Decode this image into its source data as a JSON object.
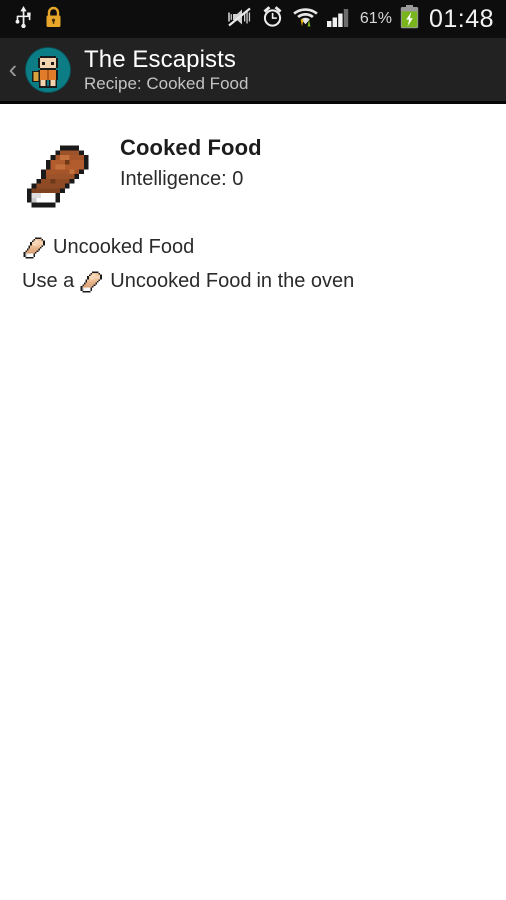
{
  "status_bar": {
    "icons": [
      "usb-icon",
      "lock-icon",
      "mute-vibrate-icon",
      "alarm-icon",
      "wifi-transfer-icon",
      "cellular-signal-icon"
    ],
    "battery_percent": "61%",
    "battery_icon": "battery-charging-icon",
    "clock": "01:48",
    "background_color": "#0d0d0d",
    "lock_color": "#e8a72b",
    "upload_arrow_color": "#79b61d",
    "download_arrow_color": "#e2b000"
  },
  "action_bar": {
    "back_label": "‹",
    "app_icon": "escapists-avatar-icon",
    "app_icon_bg": "#0d7d85",
    "title": "The Escapists",
    "subtitle": "Recipe: Cooked Food",
    "background_color": "#222222"
  },
  "item": {
    "icon": "cooked-food-icon",
    "name": "Cooked Food",
    "stat": "Intelligence: 0"
  },
  "recipe": {
    "ingredients": [
      {
        "icon": "uncooked-food-icon",
        "label": "Uncooked Food"
      }
    ],
    "instruction": {
      "prefix": "Use a",
      "icon": "uncooked-food-icon",
      "item": "Uncooked Food",
      "suffix": "in the oven"
    }
  },
  "colors": {
    "page_background": "#ffffff",
    "primary_text": "#1c1c1c",
    "secondary_text": "#2b2b2b"
  }
}
